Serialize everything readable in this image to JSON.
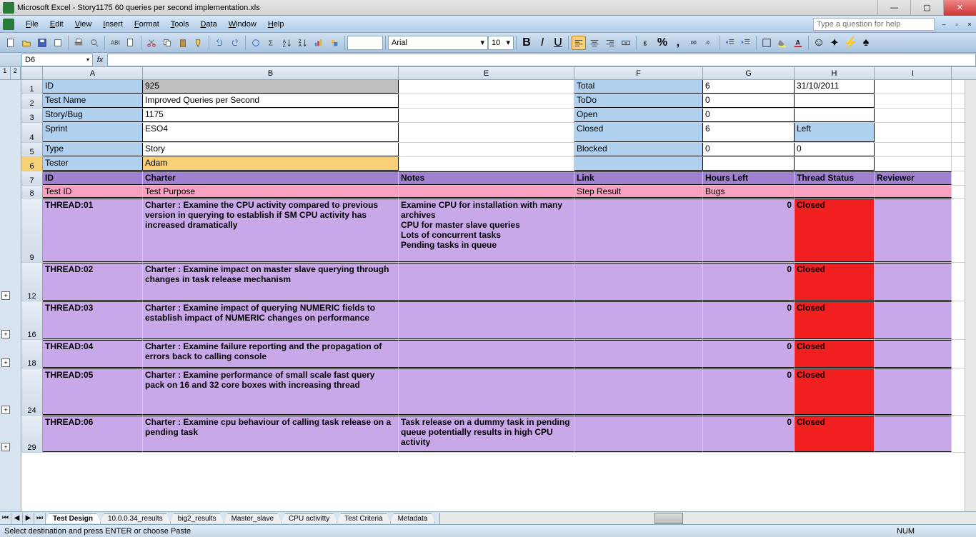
{
  "window": {
    "title": "Microsoft Excel - Story1175 60 queries per second implementation.xls"
  },
  "menu": {
    "items": [
      "File",
      "Edit",
      "View",
      "Insert",
      "Format",
      "Tools",
      "Data",
      "Window",
      "Help"
    ],
    "help_placeholder": "Type a question for help"
  },
  "toolbar": {
    "font_name": "Arial",
    "font_size": "10"
  },
  "formula": {
    "name_box": "D6",
    "fx": "fx"
  },
  "columns": [
    "A",
    "B",
    "E",
    "F",
    "G",
    "H",
    "I"
  ],
  "meta_rows": [
    {
      "num": "1",
      "A": "ID",
      "B": "925",
      "F": "Total",
      "G": "6",
      "H": "31/10/2011"
    },
    {
      "num": "2",
      "A": "Test Name",
      "B": "Improved Queries per Second",
      "F": "ToDo",
      "G": "0",
      "H": ""
    },
    {
      "num": "3",
      "A": "Story/Bug",
      "B": "1175",
      "F": "Open",
      "G": "0",
      "H": ""
    },
    {
      "num": "4",
      "A": "Sprint",
      "B": "ESO4",
      "F": "Closed",
      "G": "6",
      "H": "Left"
    },
    {
      "num": "5",
      "A": "Type",
      "B": "Story",
      "F": "Blocked",
      "G": "0",
      "H": "0"
    },
    {
      "num": "6",
      "A": "Tester",
      "B": "Adam",
      "F": "",
      "G": "",
      "H": ""
    }
  ],
  "header_row": {
    "num": "7",
    "A": "ID",
    "B": "Charter",
    "E": "Notes",
    "F": "Link",
    "G": "Hours Left",
    "H": "Thread Status",
    "I": "Reviewer"
  },
  "subheader_row": {
    "num": "8",
    "A": "Test ID",
    "B": "Test Purpose",
    "E": "",
    "F": "Step Result",
    "G": "Bugs",
    "H": "",
    "I": ""
  },
  "threads": [
    {
      "num": "9",
      "id": "THREAD:01",
      "charter": "Charter : Examine the CPU activity compared to previous version in querying to establish if SM CPU activity has increased dramatically",
      "notes": "Examine CPU for installation with many archives\nCPU for master slave queries\nLots of concurrent tasks\nPending tasks in queue",
      "hours": "0",
      "status": "Closed",
      "h": 90
    },
    {
      "num": "12",
      "id": "THREAD:02",
      "charter": "Charter : Examine impact on master slave querying through changes in task release mechanism",
      "notes": "",
      "hours": "0",
      "status": "Closed",
      "h": 54
    },
    {
      "num": "16",
      "id": "THREAD:03",
      "charter": "Charter : Examine impact of querying NUMERIC fields to establish impact of NUMERIC changes on performance",
      "notes": "",
      "hours": "0",
      "status": "Closed",
      "h": 54
    },
    {
      "num": "18",
      "id": "THREAD:04",
      "charter": "Charter : Examine failure reporting and the propagation of errors back to calling console",
      "notes": "",
      "hours": "0",
      "status": "Closed",
      "h": 40
    },
    {
      "num": "24",
      "id": "THREAD:05",
      "charter": "Charter : Examine performance of small scale fast query pack on 16 and 32 core boxes with increasing thread",
      "notes": "",
      "hours": "0",
      "status": "Closed",
      "h": 66
    },
    {
      "num": "29",
      "id": "THREAD:06",
      "charter": "Charter : Examine cpu behaviour of calling task release on a pending task",
      "notes": "Task release on a dummy task in pending queue potentially results in high CPU activity",
      "hours": "0",
      "status": "Closed",
      "h": 52
    }
  ],
  "tabs": [
    "Test Design",
    "10.0.0.34_results",
    "big2_results",
    "Master_slave",
    "CPU activitty",
    "Test Criteria",
    "Metadata"
  ],
  "status": {
    "text": "Select destination and press ENTER or choose Paste",
    "num": "NUM"
  }
}
